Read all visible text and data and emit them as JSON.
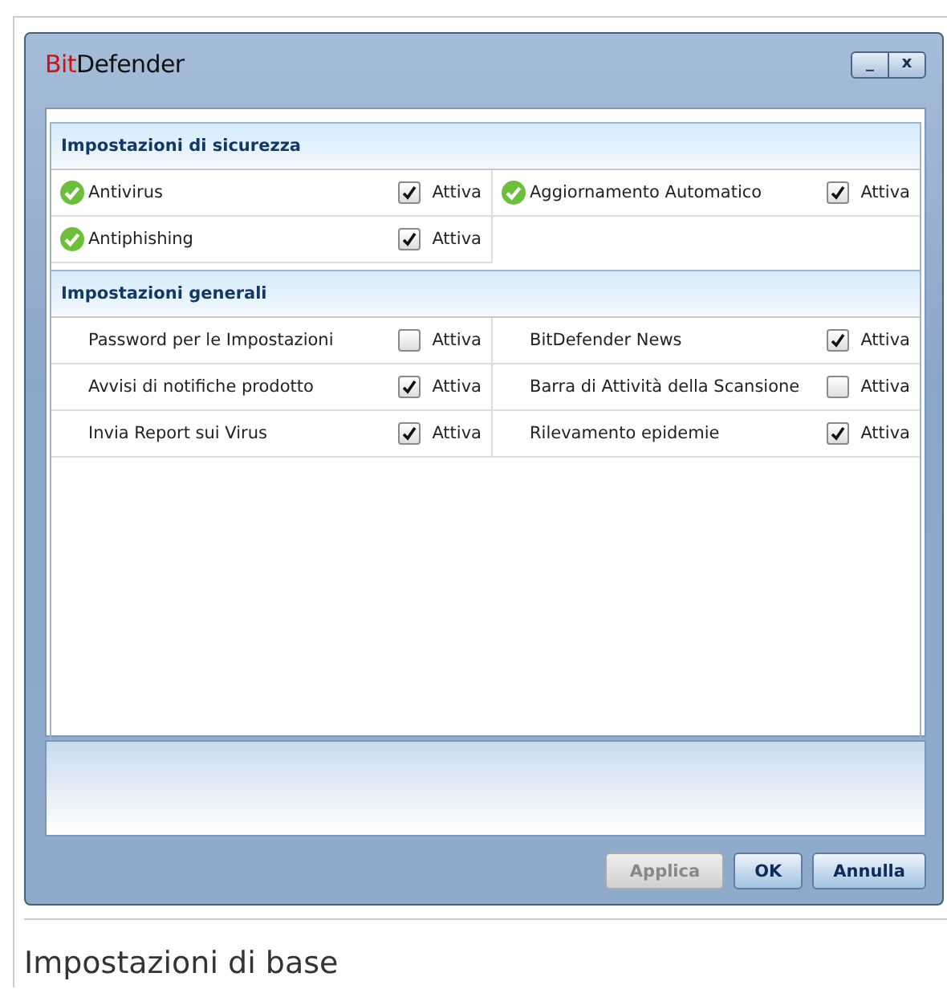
{
  "window": {
    "logo": {
      "prefix": "Bit",
      "name": "Defender"
    },
    "minimize": "_",
    "close": "x"
  },
  "sections": [
    {
      "title": "Impostazioni di sicurezza",
      "columns": [
        [
          {
            "kind": "status",
            "label": "Antivirus",
            "checked": true,
            "toggle": "Attiva"
          },
          {
            "kind": "status",
            "label": "Antiphishing",
            "checked": true,
            "toggle": "Attiva"
          }
        ],
        [
          {
            "kind": "status",
            "label": "Aggiornamento Automatico",
            "checked": true,
            "toggle": "Attiva"
          }
        ]
      ]
    },
    {
      "title": "Impostazioni generali",
      "columns": [
        [
          {
            "kind": "plain",
            "label": "Password per le Impostazioni",
            "checked": false,
            "toggle": "Attiva"
          },
          {
            "kind": "plain",
            "label": "Avvisi di notifiche prodotto",
            "checked": true,
            "toggle": "Attiva"
          },
          {
            "kind": "plain",
            "label": "Invia Report sui Virus",
            "checked": true,
            "toggle": "Attiva"
          }
        ],
        [
          {
            "kind": "plain",
            "label": "BitDefender News",
            "checked": true,
            "toggle": "Attiva"
          },
          {
            "kind": "plain",
            "label": "Barra di Attività della Scansione",
            "checked": false,
            "toggle": "Attiva"
          },
          {
            "kind": "plain",
            "label": "Rilevamento epidemie",
            "checked": true,
            "toggle": "Attiva"
          }
        ]
      ]
    }
  ],
  "buttons": [
    {
      "label": "Applica",
      "disabled": true
    },
    {
      "label": "OK",
      "disabled": false
    },
    {
      "label": "Annulla",
      "disabled": false
    }
  ],
  "caption": "Impostazioni di base"
}
